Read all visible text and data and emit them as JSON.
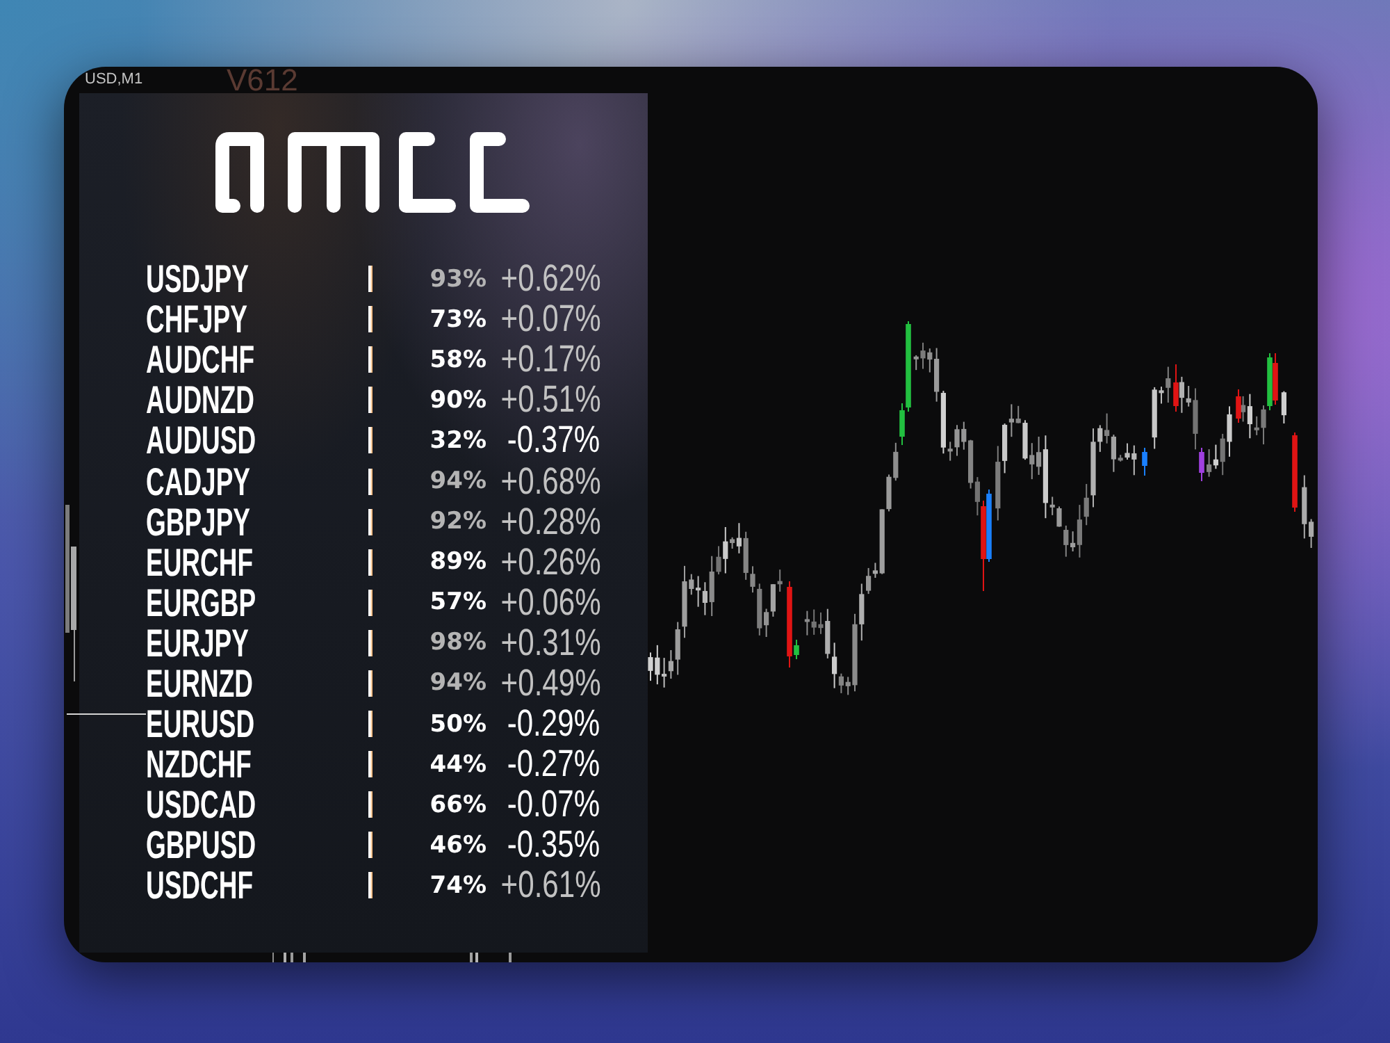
{
  "chart_header": {
    "symbol": "USD,M1",
    "version": "V612"
  },
  "panel": {
    "rows": [
      {
        "pair": "USDJPY",
        "strength": "93%",
        "strength_muted": true,
        "change": "+0.62%",
        "change_muted": true
      },
      {
        "pair": "CHFJPY",
        "strength": "73%",
        "strength_muted": false,
        "change": "+0.07%",
        "change_muted": true
      },
      {
        "pair": "AUDCHF",
        "strength": "58%",
        "strength_muted": false,
        "change": "+0.17%",
        "change_muted": true
      },
      {
        "pair": "AUDNZD",
        "strength": "90%",
        "strength_muted": false,
        "change": "+0.51%",
        "change_muted": true
      },
      {
        "pair": "AUDUSD",
        "strength": "32%",
        "strength_muted": false,
        "change": "-0.37%",
        "change_muted": false
      },
      {
        "pair": "CADJPY",
        "strength": "94%",
        "strength_muted": true,
        "change": "+0.68%",
        "change_muted": true
      },
      {
        "pair": "GBPJPY",
        "strength": "92%",
        "strength_muted": true,
        "change": "+0.28%",
        "change_muted": true
      },
      {
        "pair": "EURCHF",
        "strength": "89%",
        "strength_muted": false,
        "change": "+0.26%",
        "change_muted": true
      },
      {
        "pair": "EURGBP",
        "strength": "57%",
        "strength_muted": false,
        "change": "+0.06%",
        "change_muted": true
      },
      {
        "pair": "EURJPY",
        "strength": "98%",
        "strength_muted": true,
        "change": "+0.31%",
        "change_muted": true
      },
      {
        "pair": "EURNZD",
        "strength": "94%",
        "strength_muted": true,
        "change": "+0.49%",
        "change_muted": true
      },
      {
        "pair": "EURUSD",
        "strength": "50%",
        "strength_muted": false,
        "change": "-0.29%",
        "change_muted": false
      },
      {
        "pair": "NZDCHF",
        "strength": "44%",
        "strength_muted": false,
        "change": "-0.27%",
        "change_muted": false
      },
      {
        "pair": "USDCAD",
        "strength": "66%",
        "strength_muted": false,
        "change": "-0.07%",
        "change_muted": false
      },
      {
        "pair": "GBPUSD",
        "strength": "46%",
        "strength_muted": false,
        "change": "-0.35%",
        "change_muted": false
      },
      {
        "pair": "USDCHF",
        "strength": "74%",
        "strength_muted": false,
        "change": "+0.61%",
        "change_muted": true
      }
    ]
  }
}
